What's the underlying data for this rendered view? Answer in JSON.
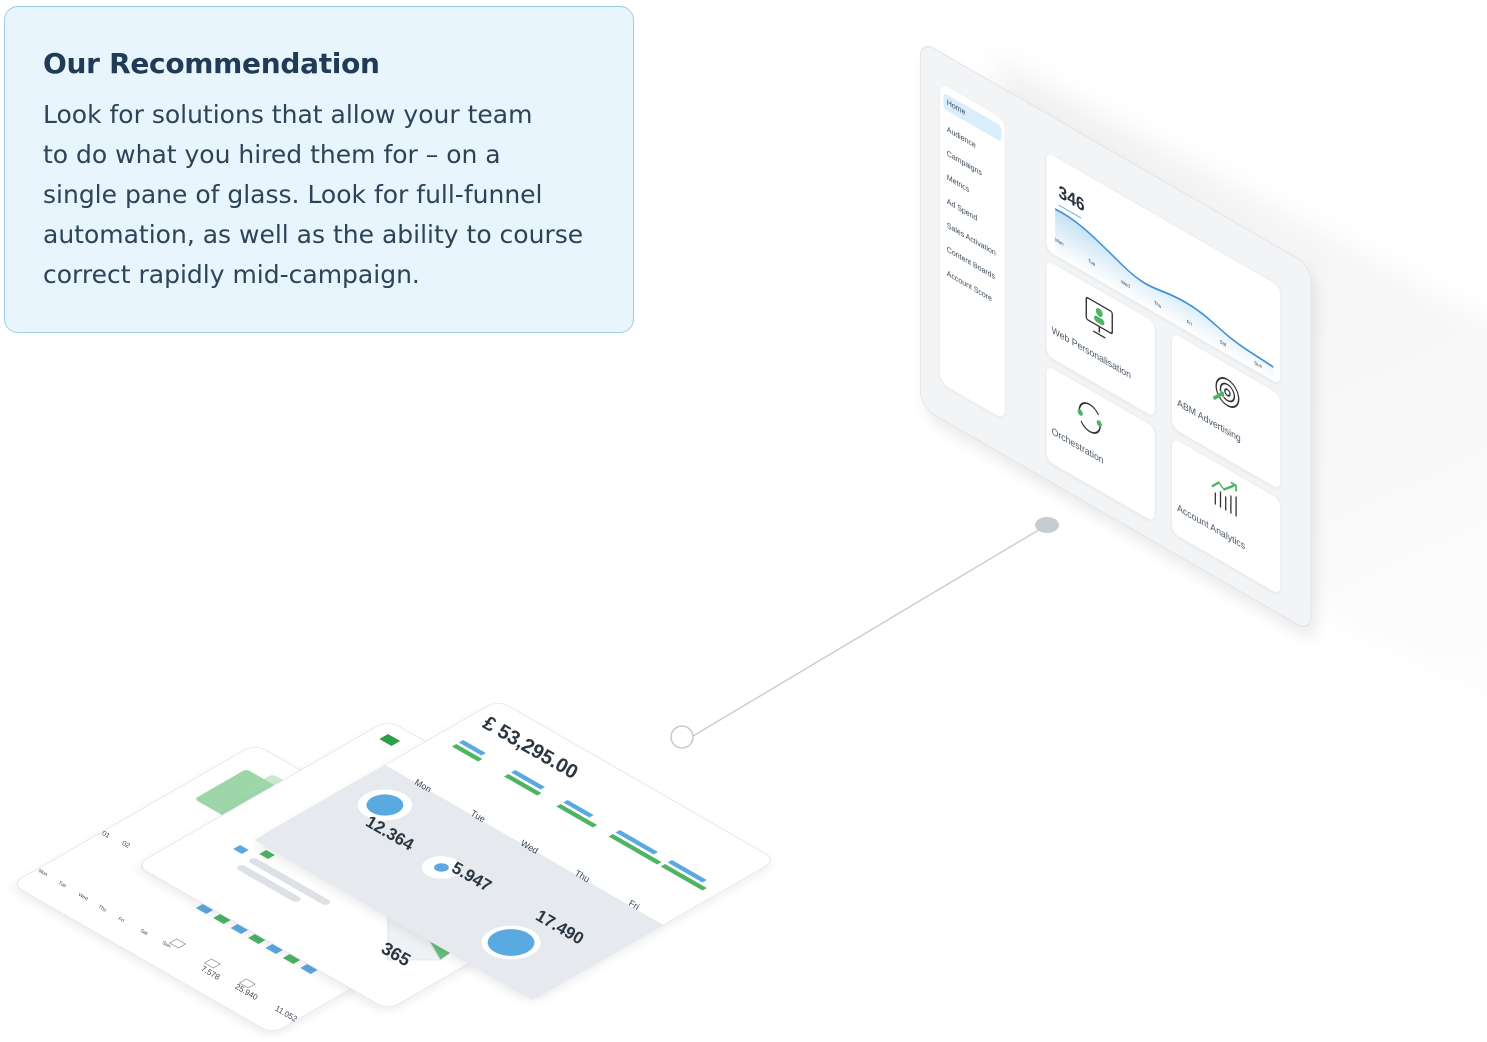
{
  "recommendation": {
    "title": "Our Recommendation",
    "lines": [
      "Look for solutions that allow your team",
      "to do what you hired them for – on a",
      "single pane of glass. Look for full-funnel",
      "automation, as well as the ability to course",
      "correct rapidly mid-campaign."
    ]
  },
  "dashboard": {
    "sidebar": [
      "Home",
      "Audience",
      "Campaigns",
      "Metrics",
      "Ad Spend",
      "Sales Activation",
      "Content Boards",
      "Account Score"
    ],
    "metric": "346",
    "chart_days": [
      "Mon",
      "Tue",
      "Wed",
      "Thu",
      "Fri",
      "Sat",
      "Sun"
    ],
    "tiles": {
      "web": "Web Personalisation",
      "abm": "ABM Advertising",
      "orch": "Orchestration",
      "analytics": "Account Analytics"
    }
  },
  "front_card": {
    "amount": "£ 53,295.00",
    "days": [
      "Mon",
      "Tue",
      "Wed",
      "Thu",
      "Fri"
    ],
    "stats": [
      "12.364",
      "5.947",
      "17.490"
    ]
  },
  "middle_card": {
    "value": "365"
  },
  "back_card": {
    "q_labels": [
      "01",
      "02"
    ],
    "days": [
      "Mon",
      "Tue",
      "Wed",
      "Thu",
      "Fri",
      "Sat",
      "Sun"
    ],
    "stats": [
      "7.578",
      "25.940",
      "11.052"
    ]
  },
  "colors": {
    "blue": "#5aa9e0",
    "green": "#4cb463",
    "box_bg": "#e8f5fc",
    "box_border": "#9ecde9"
  }
}
